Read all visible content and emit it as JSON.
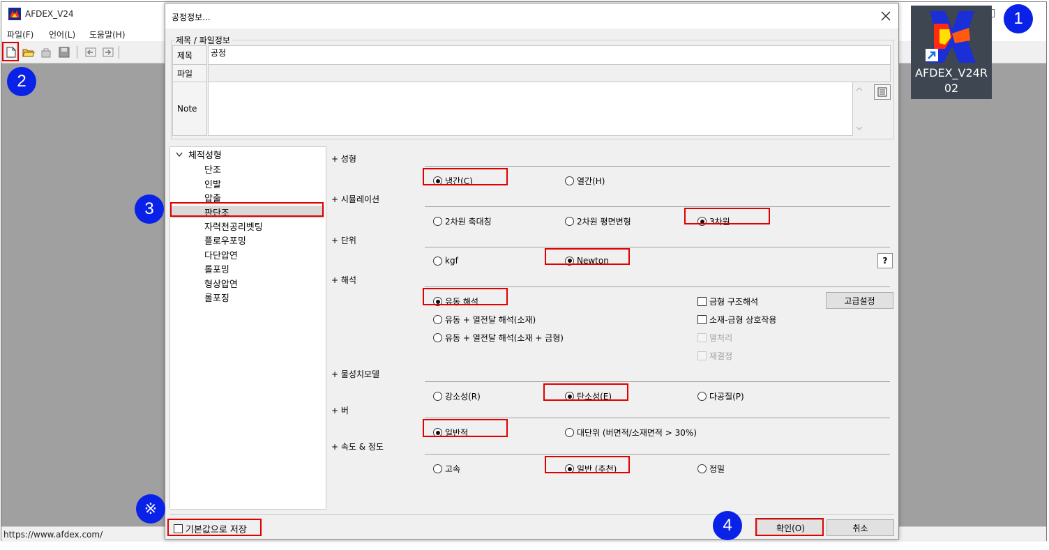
{
  "app": {
    "title": "AFDEX_V24",
    "menu": [
      "파일(F)",
      "언어(L)",
      "도움말(H)"
    ],
    "status_url": "https://www.afdex.com/"
  },
  "desktop_icon": {
    "label_line1": "AFDEX_V24R",
    "label_line2": "02"
  },
  "markers": {
    "m1": "1",
    "m2": "2",
    "m3": "3",
    "m4": "4",
    "note": "※"
  },
  "dialog": {
    "title": "공정정보...",
    "group_title": "제목 / 파일정보",
    "fields": {
      "title_label": "제목",
      "title_value": "공정",
      "file_label": "파일",
      "file_value": "",
      "note_label": "Note",
      "note_value": ""
    },
    "tree": {
      "root": "체적성형",
      "items": [
        "단조",
        "인발",
        "압출",
        "판단조",
        "자력천공리벳팅",
        "플로우포밍",
        "다단압연",
        "롤포밍",
        "형상압연",
        "롤포징"
      ],
      "selected_index": 3
    },
    "sections": {
      "forming": {
        "title": "+ 성형",
        "options": [
          {
            "label": "냉간(C)",
            "checked": true
          },
          {
            "label": "열간(H)",
            "checked": false
          }
        ]
      },
      "simulation": {
        "title": "+ 시뮬레이션",
        "options": [
          {
            "label": "2차원 축대칭",
            "checked": false
          },
          {
            "label": "2차원 평면변형",
            "checked": false
          },
          {
            "label": "3차원",
            "checked": true
          }
        ]
      },
      "unit": {
        "title": "+ 단위",
        "options": [
          {
            "label": "kgf",
            "checked": false
          },
          {
            "label": "Newton",
            "checked": true
          }
        ],
        "help_label": "?"
      },
      "analysis": {
        "title": "+ 해석",
        "options": [
          {
            "label": "유동 해석",
            "checked": true
          },
          {
            "label": "유동 + 열전달 해석(소재)",
            "checked": false
          },
          {
            "label": "유동 + 열전달 해석(소재 + 금형)",
            "checked": false
          }
        ],
        "checks": [
          {
            "label": "금형 구조해석",
            "checked": false,
            "enabled": true
          },
          {
            "label": "소재-금형 상호작용",
            "checked": false,
            "enabled": true
          },
          {
            "label": "열처리",
            "checked": false,
            "enabled": false
          },
          {
            "label": "재결정",
            "checked": false,
            "enabled": false
          }
        ],
        "advanced_button": "고급설정"
      },
      "material_model": {
        "title": "+ 물성치모델",
        "options": [
          {
            "label": "강소성(R)",
            "checked": false
          },
          {
            "label": "탄소성(E)",
            "checked": true
          },
          {
            "label": "다공질(P)",
            "checked": false
          }
        ]
      },
      "burr": {
        "title": "+ 버",
        "options": [
          {
            "label": "일반적",
            "checked": true
          },
          {
            "label": "대단위 (버면적/소재면적 > 30%)",
            "checked": false
          }
        ]
      },
      "speed": {
        "title": "+ 속도 & 정도",
        "options": [
          {
            "label": "고속",
            "checked": false
          },
          {
            "label": "일반 (추천)",
            "checked": true
          },
          {
            "label": "정밀",
            "checked": false
          }
        ]
      }
    },
    "save_default_label": "기본값으로 저장",
    "ok_button": "확인(O)",
    "cancel_button": "취소"
  },
  "colors": {
    "marker_blue": "#0a22e8",
    "highlight_red": "#e00000"
  }
}
